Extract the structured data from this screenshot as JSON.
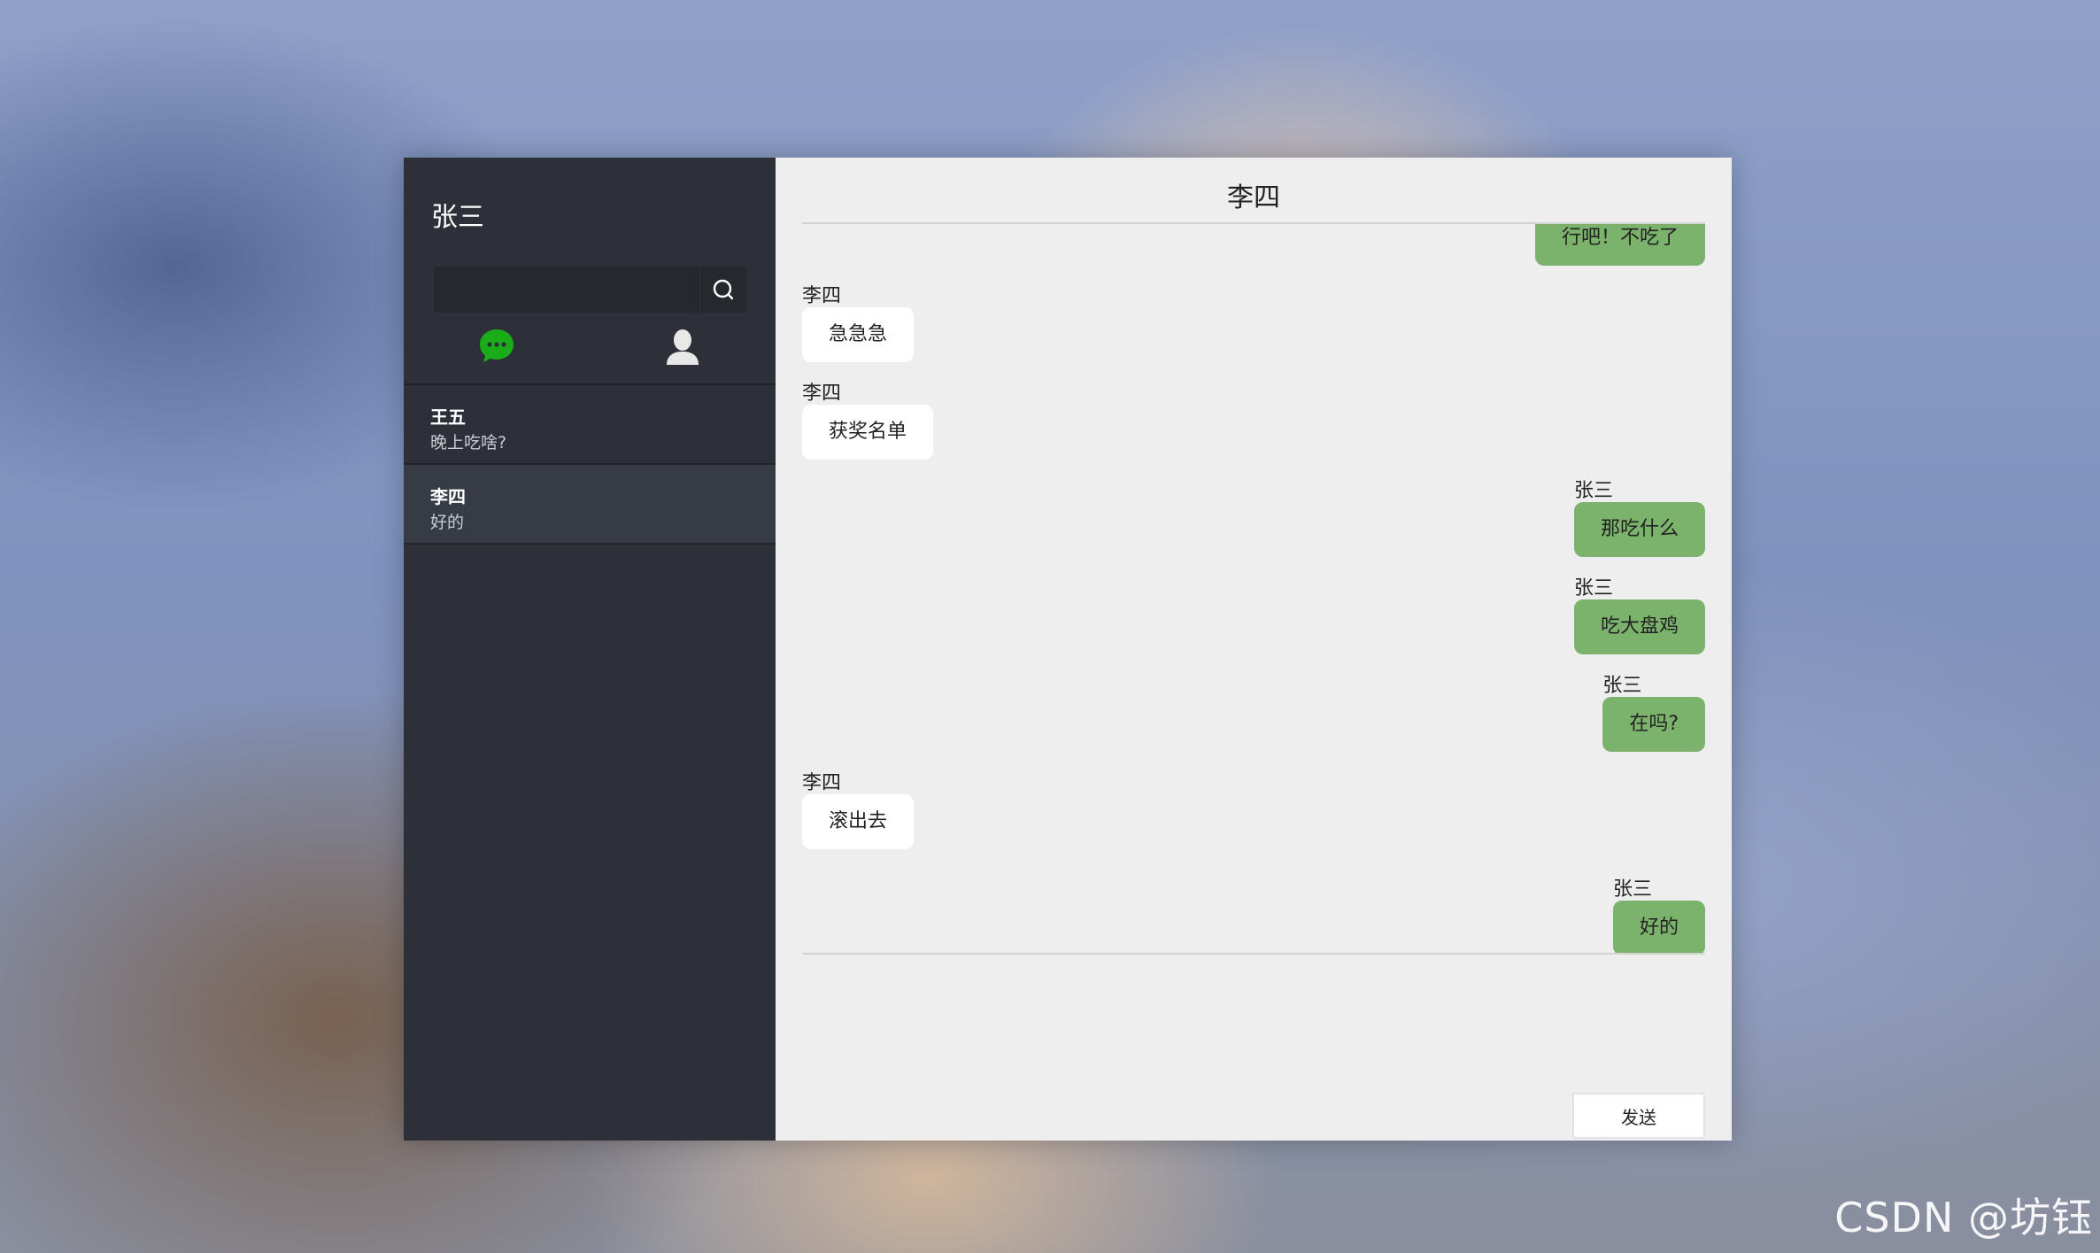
{
  "sidebar": {
    "user_name": "张三",
    "search": {
      "value": "",
      "placeholder": ""
    },
    "icons": {
      "search": "search-icon",
      "chat": "chat-bubble-icon",
      "contacts": "person-icon"
    },
    "chat_icon_color": "#1aad19",
    "conversations": [
      {
        "name": "王五",
        "preview": "晚上吃啥?"
      },
      {
        "name": "李四",
        "preview": "好的",
        "active": true
      }
    ]
  },
  "chat": {
    "title": "李四",
    "messages": [
      {
        "side": "right",
        "sender": "",
        "text": "行吧！不吃了"
      },
      {
        "side": "left",
        "sender": "李四",
        "text": "急急急"
      },
      {
        "side": "left",
        "sender": "李四",
        "text": "获奖名单"
      },
      {
        "side": "right",
        "sender": "张三",
        "text": "那吃什么"
      },
      {
        "side": "right",
        "sender": "张三",
        "text": "吃大盘鸡"
      },
      {
        "side": "right",
        "sender": "张三",
        "text": "在吗?"
      },
      {
        "side": "left",
        "sender": "李四",
        "text": "滚出去"
      },
      {
        "side": "right",
        "sender": "张三",
        "text": "好的"
      }
    ],
    "send_label": "发送",
    "colors": {
      "outgoing": "#7cb36c",
      "incoming": "#ffffff"
    }
  },
  "watermark": "CSDN @坊钰"
}
